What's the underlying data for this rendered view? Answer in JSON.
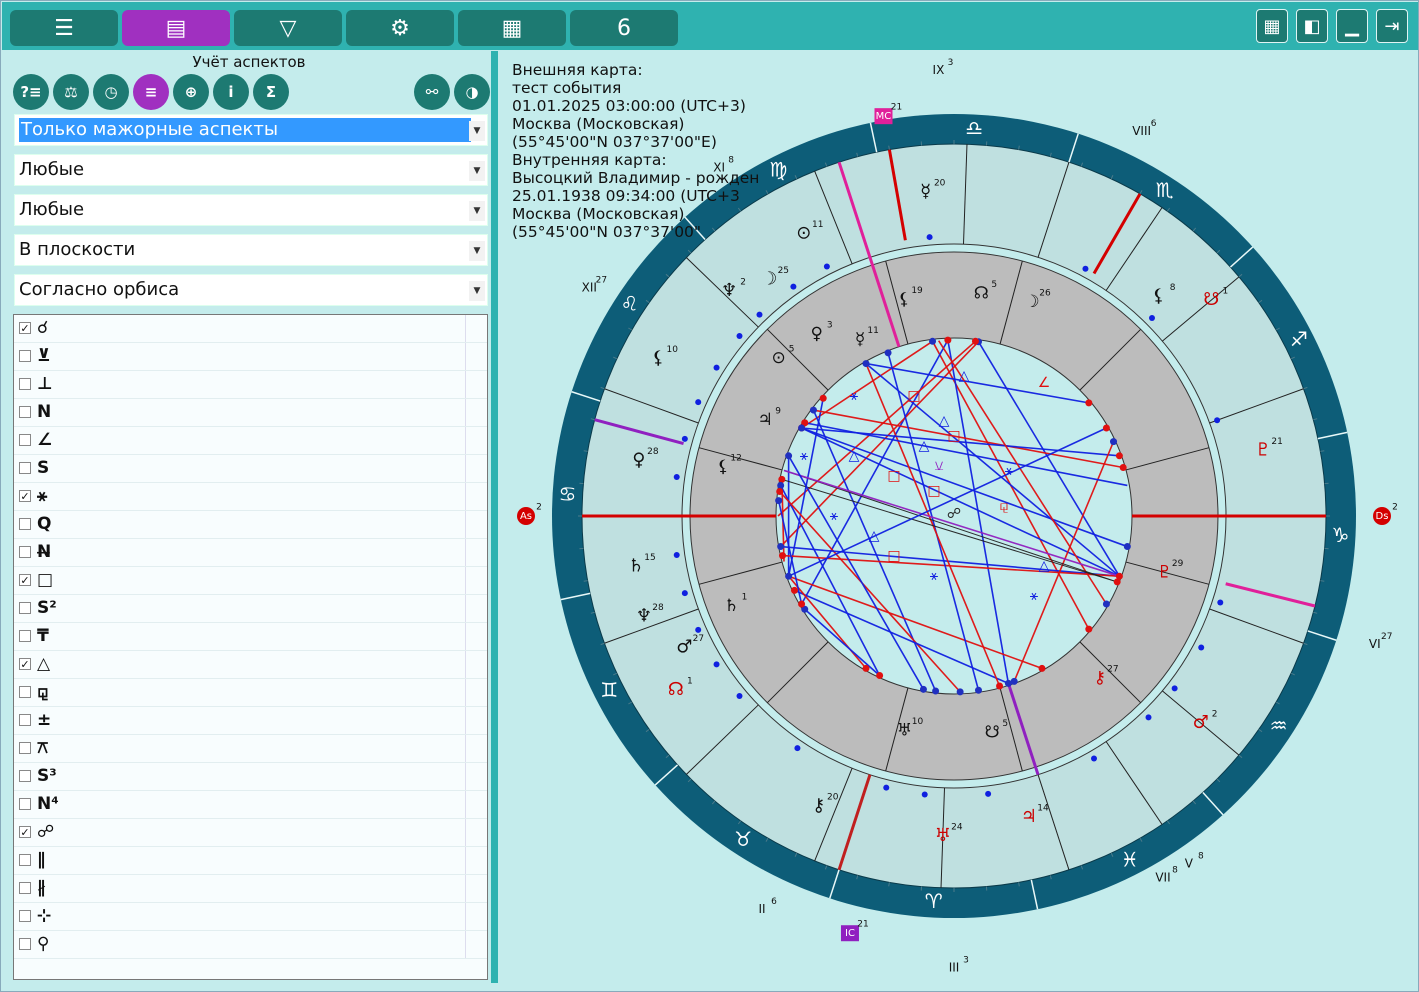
{
  "toolbar": {
    "tabs": [
      {
        "icon": "menu-lines-icon",
        "glyph": "☰",
        "active": false
      },
      {
        "icon": "layout-list-icon",
        "glyph": "▤",
        "active": true
      },
      {
        "icon": "dropdown-box-icon",
        "glyph": "▽",
        "active": false
      },
      {
        "icon": "gear-icon",
        "glyph": "⚙",
        "active": false
      },
      {
        "icon": "document-grid-icon",
        "glyph": "▦",
        "active": false
      },
      {
        "icon": "spiral-logo-icon",
        "glyph": "6",
        "active": false
      }
    ],
    "right_buttons": [
      {
        "icon": "grid-icon",
        "glyph": "▦"
      },
      {
        "icon": "panel-toggle-icon",
        "glyph": "◧"
      },
      {
        "icon": "minimize-icon",
        "glyph": "▁"
      },
      {
        "icon": "exit-icon",
        "glyph": "⇥"
      }
    ]
  },
  "left_panel": {
    "title": "Учёт аспектов",
    "tool_buttons": [
      {
        "icon": "help-list-icon",
        "glyph": "?≡",
        "active": false
      },
      {
        "icon": "filter-list-icon",
        "glyph": "⚖",
        "active": false
      },
      {
        "icon": "clock-list-icon",
        "glyph": "◷",
        "active": false
      },
      {
        "icon": "aspects-list-icon",
        "glyph": "≡",
        "active": true
      },
      {
        "icon": "globe-list-icon",
        "glyph": "⊕",
        "active": false
      },
      {
        "icon": "info-icon",
        "glyph": "i",
        "active": false
      },
      {
        "icon": "sum-icon",
        "glyph": "Σ",
        "active": false
      }
    ],
    "extra_buttons": [
      {
        "icon": "aspect-graph-icon",
        "glyph": "⚯"
      },
      {
        "icon": "chart-wheel-icon",
        "glyph": "◑"
      }
    ],
    "dropdowns": [
      {
        "value": "Только мажорные аспекты",
        "selected": true
      },
      {
        "value": "Любые",
        "selected": false
      },
      {
        "value": "Любые",
        "selected": false
      },
      {
        "value": "В плоскости",
        "selected": false
      },
      {
        "value": "Согласно орбиса",
        "selected": false
      }
    ],
    "aspects": [
      {
        "symbol": "☌",
        "checked": true
      },
      {
        "symbol": "⊻",
        "checked": false
      },
      {
        "symbol": "⊥",
        "checked": false
      },
      {
        "symbol": "N",
        "checked": false
      },
      {
        "symbol": "∠",
        "checked": false
      },
      {
        "symbol": "S",
        "checked": false
      },
      {
        "symbol": "⚹",
        "checked": true
      },
      {
        "symbol": "Q",
        "checked": false
      },
      {
        "symbol": "N̶",
        "checked": false
      },
      {
        "symbol": "□",
        "checked": true
      },
      {
        "symbol": "S²",
        "checked": false
      },
      {
        "symbol": "₸",
        "checked": false
      },
      {
        "symbol": "△",
        "checked": true
      },
      {
        "symbol": "⚼",
        "checked": false
      },
      {
        "symbol": "±",
        "checked": false
      },
      {
        "symbol": "⚻",
        "checked": false
      },
      {
        "symbol": "S³",
        "checked": false
      },
      {
        "symbol": "N⁴",
        "checked": false
      },
      {
        "symbol": "☍",
        "checked": true
      },
      {
        "symbol": "∥",
        "checked": false
      },
      {
        "symbol": "∦",
        "checked": false
      },
      {
        "symbol": "⊹",
        "checked": false
      },
      {
        "symbol": "⚲",
        "checked": false
      }
    ]
  },
  "chart": {
    "info_lines": [
      "Внешняя карта:",
      "тест события",
      "01.01.2025 03:00:00 (UTC+3)",
      "Москва (Московская)",
      "(55°45'00\"N 037°37'00\"E)",
      "Внутренняя карта:",
      "Высоцкий Владимир - рожден",
      "25.01.1938 09:34:00 (UTC+3",
      "Москва (Московская)",
      "(55°45'00\"N 037°37'00\""
    ],
    "colors": {
      "zodiac_ring": "#0d5d78",
      "outer_band": "#bfe0e0",
      "inner_band": "#bcbcbc",
      "background": "#c4ecec",
      "axis_red": "#d40000",
      "mc_magenta": "#e0209a",
      "ic_purple": "#9020c0",
      "blue_aspect": "#1020e0",
      "red_aspect": "#e01010",
      "active_tab": "#a030c0",
      "tab": "#1d7a72"
    },
    "zodiac_glyphs": [
      "♐",
      "♏",
      "♎",
      "♍",
      "♌",
      "♋",
      "♊",
      "♉",
      "♈",
      "♓",
      "♒",
      "♑"
    ],
    "angle_labels": [
      {
        "name": "MC",
        "deg": "21",
        "color": "#e0209a"
      },
      {
        "name": "As",
        "deg": "2",
        "color": "#d40000"
      },
      {
        "name": "Ds",
        "deg": "2",
        "color": "#d40000"
      },
      {
        "name": "IC",
        "deg": "21",
        "color": "#9020c0"
      }
    ],
    "house_cusps": [
      {
        "num": "IX",
        "deg": "3"
      },
      {
        "num": "VIII",
        "deg": "6"
      },
      {
        "num": "VII",
        "deg": "8"
      },
      {
        "num": "VI",
        "deg": "27"
      },
      {
        "num": "V",
        "deg": "8"
      },
      {
        "num": "III",
        "deg": "3"
      },
      {
        "num": "II",
        "deg": "6"
      },
      {
        "num": "XII",
        "deg": "27"
      },
      {
        "num": "XI",
        "deg": "8"
      }
    ],
    "outer_planets": [
      {
        "glyph": "☿",
        "deg": "20",
        "color": "#111"
      },
      {
        "glyph": "⊙",
        "deg": "11",
        "color": "#111"
      },
      {
        "glyph": "♆",
        "deg": "2",
        "color": "#111"
      },
      {
        "glyph": "☽",
        "deg": "25",
        "color": "#111"
      },
      {
        "glyph": "⚸",
        "deg": "10",
        "color": "#111"
      },
      {
        "glyph": "♀",
        "deg": "28",
        "color": "#111"
      },
      {
        "glyph": "♄",
        "deg": "15",
        "color": "#111"
      },
      {
        "glyph": "♂",
        "deg": "27",
        "color": "#111"
      },
      {
        "glyph": "♆",
        "deg": "28",
        "color": "#111"
      },
      {
        "glyph": "☊",
        "deg": "1",
        "color": "#c00"
      },
      {
        "glyph": "⚷",
        "deg": "20",
        "color": "#111"
      },
      {
        "glyph": "♅",
        "deg": "24",
        "color": "#c00"
      },
      {
        "glyph": "♃",
        "deg": "14",
        "color": "#c00"
      },
      {
        "glyph": "♂",
        "deg": "2",
        "color": "#c00"
      },
      {
        "glyph": "♇",
        "deg": "21",
        "color": "#c00"
      },
      {
        "glyph": "☋",
        "deg": "1",
        "color": "#c00"
      },
      {
        "glyph": "⚸",
        "deg": "8",
        "color": "#111"
      }
    ],
    "inner_planets": [
      {
        "glyph": "⚸",
        "deg": "19",
        "color": "#111"
      },
      {
        "glyph": "☊",
        "deg": "5",
        "color": "#111"
      },
      {
        "glyph": "☽",
        "deg": "26",
        "color": "#111"
      },
      {
        "glyph": "☿",
        "deg": "11",
        "color": "#111"
      },
      {
        "glyph": "⊙",
        "deg": "5",
        "color": "#111"
      },
      {
        "glyph": "♀",
        "deg": "3",
        "color": "#111"
      },
      {
        "glyph": "♃",
        "deg": "9",
        "color": "#111"
      },
      {
        "glyph": "⚸",
        "deg": "12",
        "color": "#111"
      },
      {
        "glyph": "♄",
        "deg": "1",
        "color": "#111"
      },
      {
        "glyph": "♅",
        "deg": "10",
        "color": "#111"
      },
      {
        "glyph": "☋",
        "deg": "5",
        "color": "#111"
      },
      {
        "glyph": "⚷",
        "deg": "27",
        "color": "#c00"
      },
      {
        "glyph": "♇",
        "deg": "29",
        "color": "#c00"
      }
    ],
    "aspect_symbols": [
      "⚹",
      "□",
      "△",
      "☍",
      "∠",
      "⚺",
      "⚼"
    ]
  }
}
